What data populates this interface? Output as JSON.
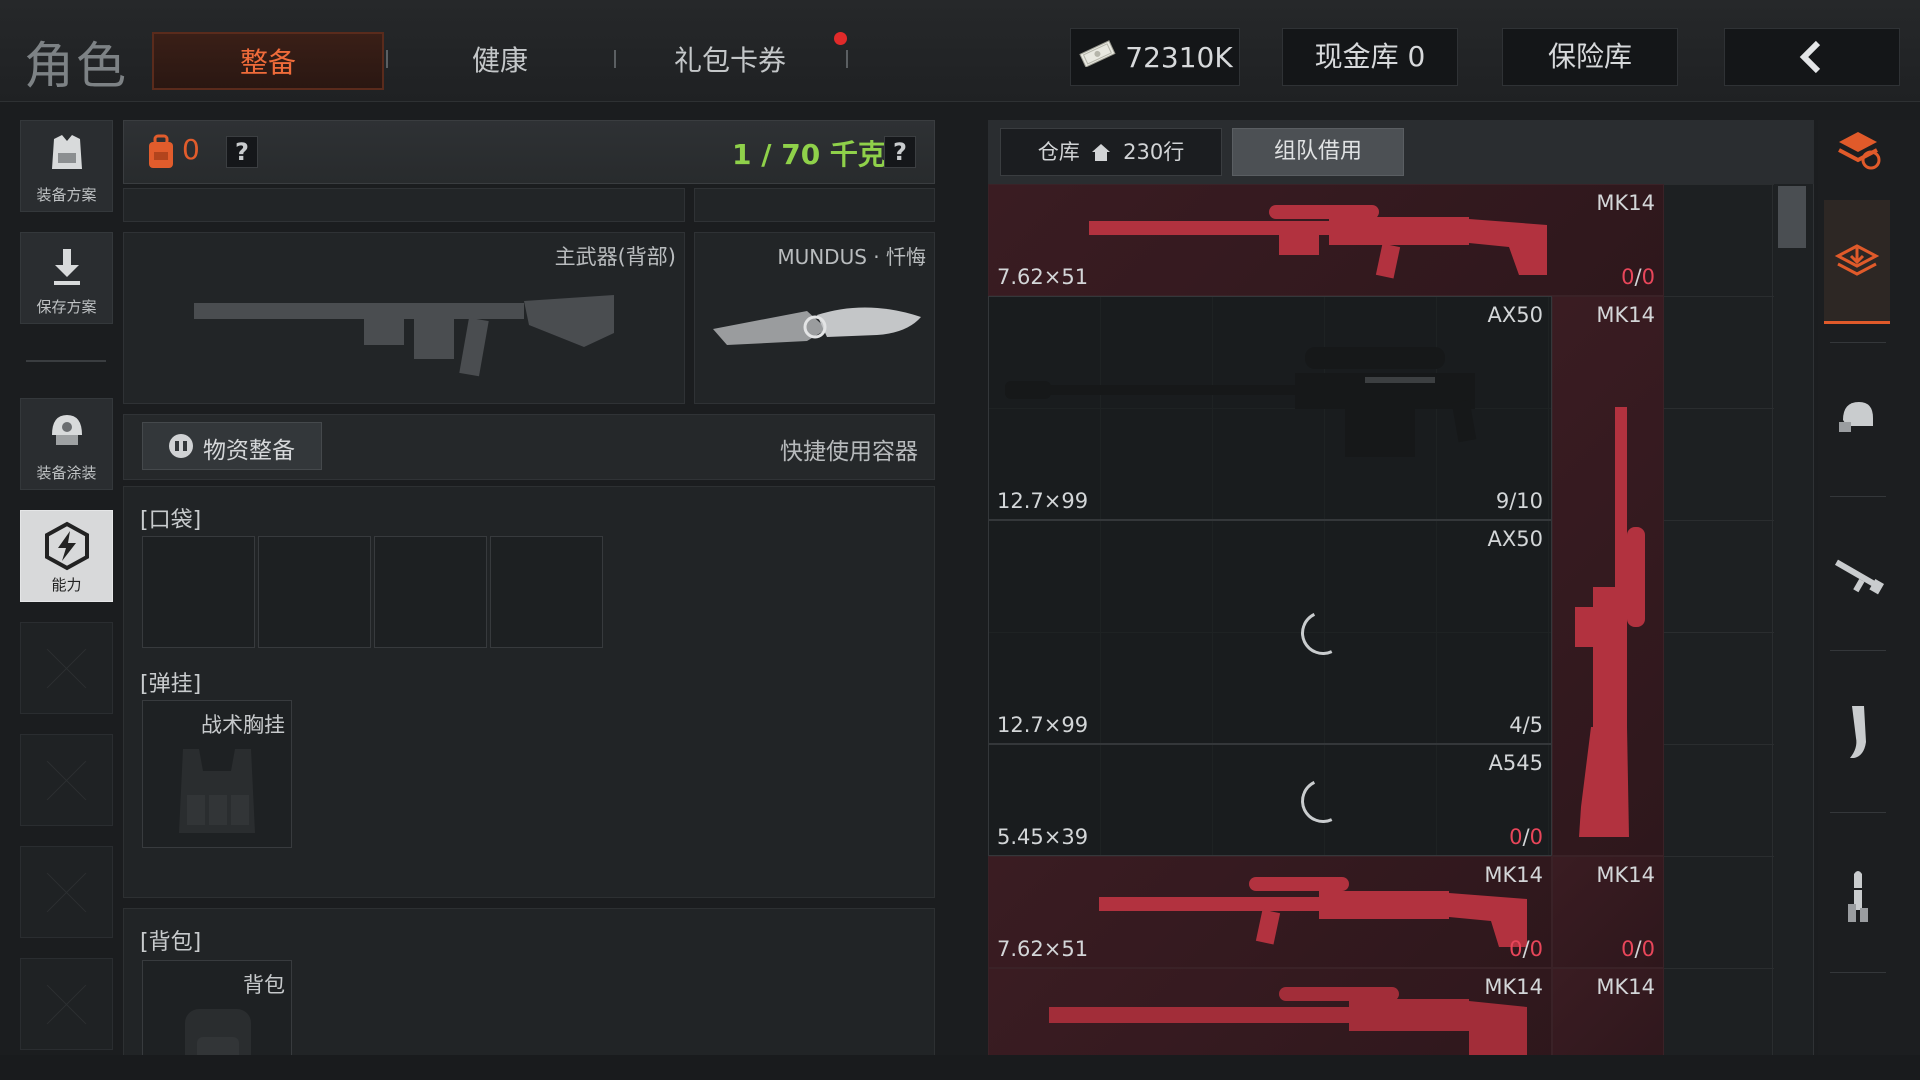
{
  "header": {
    "title": "角色",
    "tabs": [
      {
        "label": "整备",
        "active": true
      },
      {
        "label": "健康",
        "active": false
      },
      {
        "label": "礼包卡券",
        "active": false,
        "has_notification": true
      }
    ],
    "money": "72310K",
    "cash_vault": "现金库 0",
    "safe_box": "保险库",
    "back_icon": "chevron-left-icon"
  },
  "sidebar": {
    "items": [
      {
        "label": "装备方案",
        "icon": "vest-icon"
      },
      {
        "label": "保存方案",
        "icon": "download-icon"
      },
      {
        "label": "装备涂装",
        "icon": "helmet-icon"
      },
      {
        "label": "能力",
        "icon": "lightning-icon",
        "active": true
      }
    ]
  },
  "loadout": {
    "backpack_count": "0",
    "help": "?",
    "weight": "1 / 70 千克",
    "primary_weapon_label": "主武器(背部)",
    "melee_label": "MUNDUS · 忏悔",
    "supply_button": "物资整备",
    "quick_container": "快捷使用容器",
    "pocket_label": "[口袋]",
    "rig_label": "[弹挂]",
    "rig_item": "战术胸挂",
    "backpack_section_label": "[背包]",
    "backpack_item": "背包"
  },
  "storage": {
    "warehouse_tab": "仓库",
    "warehouse_rows": "230行",
    "team_borrow_tab": "组队借用",
    "items": [
      {
        "name": "MK14",
        "caliber": "7.62×51",
        "count_have": "0",
        "count_sep": "/",
        "count_max": "0",
        "color": "red",
        "loading": false
      },
      {
        "name": "AX50",
        "caliber": "12.7×99",
        "count": "9/10",
        "color": "dark",
        "loading": false
      },
      {
        "name": "AX50",
        "caliber": "12.7×99",
        "count": "4/5",
        "color": "dark",
        "loading": true
      },
      {
        "name": "A545",
        "caliber": "5.45×39",
        "count_have": "0",
        "count_sep": "/",
        "count_max": "0",
        "color": "dark",
        "loading": true
      },
      {
        "name": "MK14",
        "caliber": "7.62×51",
        "count_have": "0",
        "count_sep": "/",
        "count_max": "0",
        "color": "red",
        "loading": false
      },
      {
        "name": "MK14",
        "color": "red"
      },
      {
        "name": "MK14",
        "color": "red"
      },
      {
        "name": "MK14",
        "count_have": "0",
        "count_sep": "/",
        "count_max": "0",
        "color": "red"
      },
      {
        "name": "MK14",
        "color": "red"
      }
    ]
  },
  "categories": [
    "all-items-icon",
    "stash-icon",
    "armor-icon",
    "rifle-icon",
    "magazine-icon",
    "ammo-icon"
  ],
  "colors": {
    "accent": "#e05a2a",
    "weight_ok": "#8fd14a",
    "zero_count": "#e8465a",
    "rare_red": "#3a1c22"
  }
}
